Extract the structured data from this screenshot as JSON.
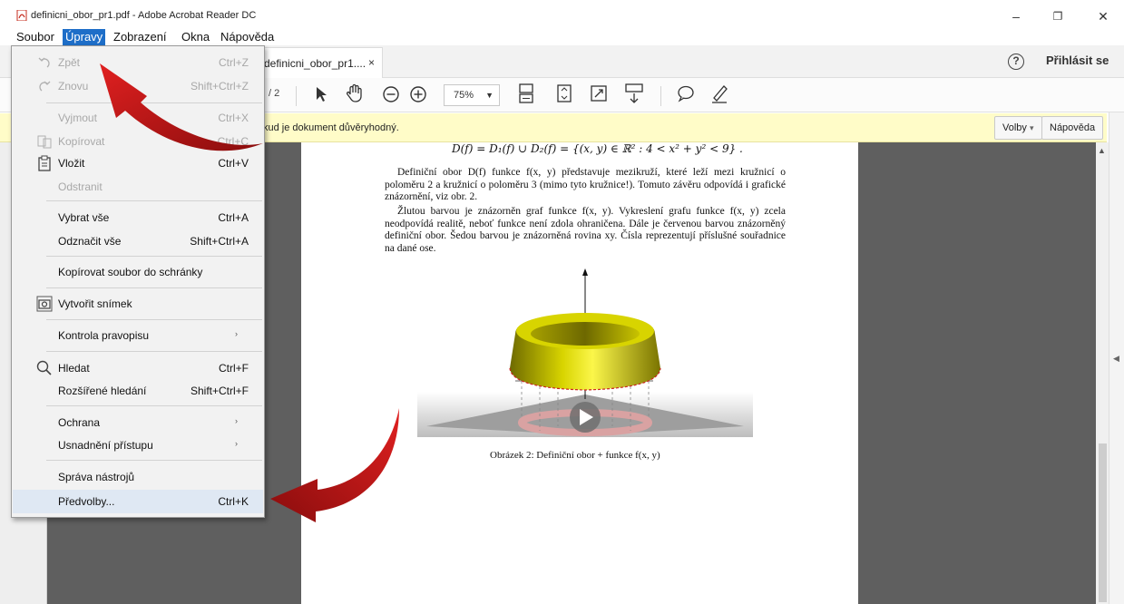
{
  "window": {
    "title": "definicni_obor_pr1.pdf - Adobe Acrobat Reader DC",
    "minimize": "–",
    "restore": "❐",
    "close": "✕"
  },
  "menubar": {
    "items": [
      "Soubor",
      "Úpravy",
      "Zobrazení",
      "Okna",
      "Nápověda"
    ],
    "active": "Úpravy"
  },
  "tabs": {
    "document_tab": "definicni_obor_pr1....",
    "close_glyph": "×",
    "help": "?",
    "signin": "Přihlásit se"
  },
  "toolbar": {
    "page_total": "/ 2",
    "zoom": "75%"
  },
  "notification": {
    "text": "kud je dokument důvěryhodný.",
    "options_button": "Volby",
    "options_caret": "▾",
    "help_button": "Nápověda"
  },
  "document": {
    "formula": "D(f) = D₁(f) ∪ D₂(f) = {(x, y) ∈ ℝ² : 4 < x² + y² < 9} .",
    "para1": "Definiční obor D(f) funkce f(x, y) představuje mezikruží, které leží mezi kružnicí o poloměru 2 a kružnicí o poloměru 3 (mimo tyto kružnice!). Tomuto závěru odpovídá i grafické znázornění, viz obr. 2.",
    "para2": "Žlutou barvou je znázorněn graf funkce f(x, y). Vykreslení grafu funkce f(x, y) zcela neodpovídá realitě, neboť funkce není zdola ohraničena. Dále je červenou barvou znázorněný definiční obor. Šedou barvou je znázorněná rovina xy. Čísla reprezentují příslušné souřadnice na dané ose.",
    "caption": "Obrázek 2: Definiční obor + funkce f(x, y)"
  },
  "edit_menu": {
    "items": [
      {
        "label": "Zpět",
        "shortcut": "Ctrl+Z",
        "icon": "undo-icon",
        "disabled": true
      },
      {
        "label": "Znovu",
        "shortcut": "Shift+Ctrl+Z",
        "icon": "redo-icon",
        "disabled": true
      },
      {
        "label": "Vyjmout",
        "shortcut": "Ctrl+X",
        "disabled": true
      },
      {
        "label": "Kopírovat",
        "shortcut": "Ctrl+C",
        "icon": "copy-icon",
        "disabled": true
      },
      {
        "label": "Vložit",
        "shortcut": "Ctrl+V",
        "icon": "paste-icon",
        "disabled": false
      },
      {
        "label": "Odstranit",
        "shortcut": "",
        "disabled": true
      },
      {
        "label": "Vybrat vše",
        "shortcut": "Ctrl+A",
        "disabled": false
      },
      {
        "label": "Odznačit vše",
        "shortcut": "Shift+Ctrl+A",
        "disabled": false
      },
      {
        "label": "Kopírovat soubor do schránky",
        "shortcut": "",
        "disabled": false
      },
      {
        "label": "Vytvořit snímek",
        "shortcut": "",
        "icon": "camera-icon",
        "disabled": false
      },
      {
        "label": "Kontrola pravopisu",
        "shortcut": "",
        "submenu": true,
        "disabled": false
      },
      {
        "label": "Hledat",
        "shortcut": "Ctrl+F",
        "icon": "search-icon",
        "disabled": false
      },
      {
        "label": "Rozšířené hledání",
        "shortcut": "Shift+Ctrl+F",
        "disabled": false
      },
      {
        "label": "Ochrana",
        "shortcut": "",
        "submenu": true,
        "disabled": false
      },
      {
        "label": "Usnadnění přístupu",
        "shortcut": "",
        "submenu": true,
        "disabled": false
      },
      {
        "label": "Správa nástrojů",
        "shortcut": "",
        "disabled": false
      },
      {
        "label": "Předvolby...",
        "shortcut": "Ctrl+K",
        "highlighted": true,
        "disabled": false
      }
    ],
    "submenu_glyph": "›"
  },
  "colors": {
    "menu_active": "#1e6ec8",
    "notification_bg": "#fffcc8",
    "arrow_red": "#c8161a",
    "surface_yellow": "#c9c400"
  }
}
